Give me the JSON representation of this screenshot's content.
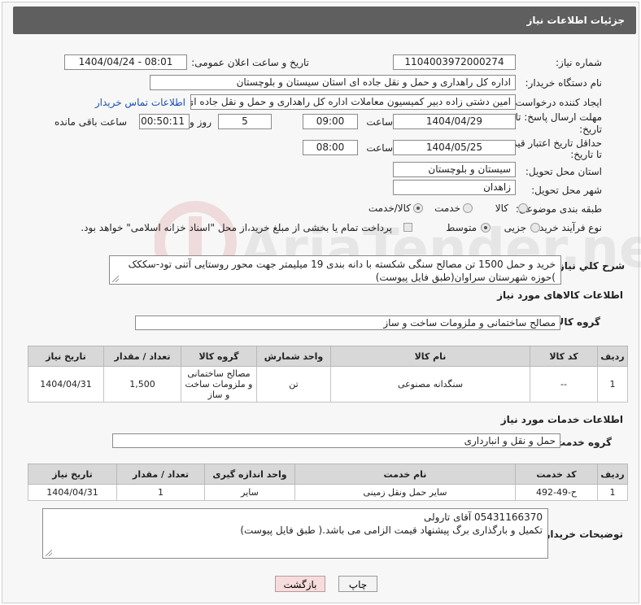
{
  "header": {
    "title": "جزئیات اطلاعات نیاز"
  },
  "fields": {
    "need_number_label": "شماره نیاز:",
    "need_number": "1104003972000274",
    "announce_label": "تاریخ و ساعت اعلان عمومی:",
    "announce_value": "1404/04/24 - 08:01",
    "buyer_org_label": "نام دستگاه خریدار:",
    "buyer_org": "اداره کل راهداری و حمل و نقل جاده ای استان سیستان و بلوچستان",
    "requester_label": "ایجاد کننده درخواست:",
    "requester": "امین دشتی زاده دبیر کمیسیون معاملات اداره کل راهداری و حمل و نقل جاده ای",
    "contact_link": "اطلاعات تماس خریدار",
    "reply_deadline_label_1": "مهلت ارسال پاسخ: تا",
    "reply_deadline_label_2": "تاریخ:",
    "reply_date": "1404/04/29",
    "time_label": "ساعت",
    "reply_time": "09:00",
    "days_value": "5",
    "days_label": "روز و",
    "remaining_time": "00:50:11",
    "remaining_label": "ساعت باقی مانده",
    "price_deadline_label_1": "حداقل تاریخ اعتبار قیمت:",
    "price_deadline_label_2": "تا تاریخ:",
    "price_date": "1404/05/25",
    "price_time": "08:00",
    "province_label": "استان محل تحویل:",
    "province": "سیستان و بلوچستان",
    "city_label": "شهر محل تحویل:",
    "city": "زاهدان",
    "category_label": "طبقه بندی موضوعی:",
    "category_options": [
      "کالا",
      "خدمت",
      "کالا/خدمت"
    ],
    "category_selected": "کالا/خدمت",
    "purchase_type_label": "نوع فرآیند خرید :",
    "purchase_options": [
      "جزیی",
      "متوسط"
    ],
    "purchase_selected": "متوسط",
    "payment_note": "پرداخت تمام یا بخشی از مبلغ خرید،از محل \"اسناد خزانه اسلامی\" خواهد بود."
  },
  "description": {
    "label": "شرح کلي نياز:",
    "text": "خرید و حمل 1500 تن مصالح سنگی شکسته با دانه بندی 19 میلیمتر جهت محور روستایی آتنی تود-سککک )حوزه شهرستان سراوان(طبق فایل پیوست)"
  },
  "goods": {
    "section_title": "اطلاعات کالاهای مورد نیاز",
    "group_label": "گروه کالا:",
    "group_value": "مصالح ساختمانی و ملزومات ساخت و ساز",
    "columns": [
      "ردیف",
      "کد کالا",
      "نام کالا",
      "واحد شمارش",
      "گروه کالا",
      "تعداد / مقدار",
      "تاریخ نیاز"
    ],
    "rows": [
      [
        "1",
        "--",
        "سنگدانه مصنوعی",
        "تن",
        "مصالح ساختمانی و ملزومات ساخت و ساز",
        "1,500",
        "1404/04/31"
      ]
    ]
  },
  "services": {
    "section_title": "اطلاعات خدمات مورد نیاز",
    "group_label": "گروه خدمت:",
    "group_value": "حمل و نقل و انبارداری",
    "columns": [
      "ردیف",
      "کد خدمت",
      "نام خدمت",
      "واحد اندازه گیری",
      "تعداد / مقدار",
      "تاریخ نیاز"
    ],
    "rows": [
      [
        "1",
        "ح-49-492",
        "سایر حمل ونقل زمینی",
        "سایر",
        "1",
        "1404/04/31"
      ]
    ]
  },
  "buyer_notes": {
    "label": "توضیحات خریدار:",
    "line1": "05431166370 آقای تارولی",
    "line2": "تکمیل و بارگذاری برگ پیشنهاد قیمت الزامی می باشد.( طبق فایل پیوست)"
  },
  "buttons": {
    "print": "چاپ",
    "back": "بازگشت"
  },
  "watermark_text": "AriaTender.neT",
  "colors": {
    "header_bg": "#5f5f5f",
    "link": "#1a4fb3",
    "back_button_bg": "#f6dcdc"
  }
}
